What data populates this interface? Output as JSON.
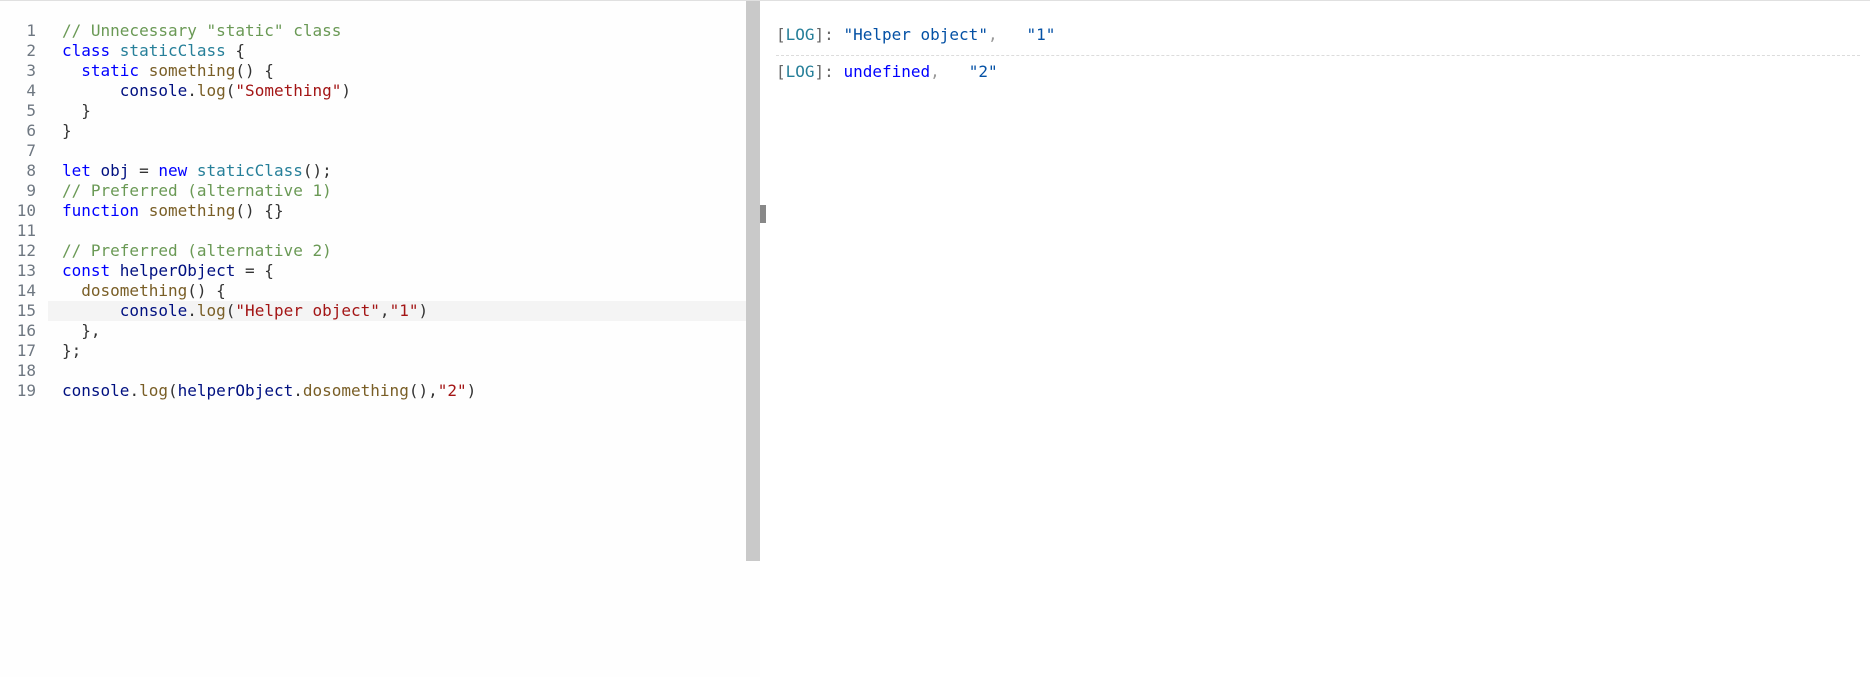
{
  "editor": {
    "highlighted_line_index": 14,
    "lines": [
      {
        "num": 1,
        "tokens": [
          {
            "t": "// Unnecessary \"static\" class",
            "c": "tok-comment"
          }
        ]
      },
      {
        "num": 2,
        "tokens": [
          {
            "t": "class ",
            "c": "tok-keyword"
          },
          {
            "t": "staticClass",
            "c": "tok-ident"
          },
          {
            "t": " {",
            "c": "tok-punct"
          }
        ]
      },
      {
        "num": 3,
        "tokens": [
          {
            "t": "  ",
            "c": ""
          },
          {
            "t": "static ",
            "c": "tok-keyword"
          },
          {
            "t": "something",
            "c": "tok-func"
          },
          {
            "t": "() {",
            "c": "tok-punct"
          }
        ]
      },
      {
        "num": 4,
        "tokens": [
          {
            "t": "      ",
            "c": ""
          },
          {
            "t": "console",
            "c": "tok-var"
          },
          {
            "t": ".",
            "c": "tok-punct"
          },
          {
            "t": "log",
            "c": "tok-func"
          },
          {
            "t": "(",
            "c": "tok-punct"
          },
          {
            "t": "\"Something\"",
            "c": "tok-string"
          },
          {
            "t": ")",
            "c": "tok-punct"
          }
        ]
      },
      {
        "num": 5,
        "tokens": [
          {
            "t": "  }",
            "c": "tok-punct"
          }
        ]
      },
      {
        "num": 6,
        "tokens": [
          {
            "t": "}",
            "c": "tok-punct"
          }
        ]
      },
      {
        "num": 7,
        "tokens": [
          {
            "t": "",
            "c": ""
          }
        ]
      },
      {
        "num": 8,
        "tokens": [
          {
            "t": "let ",
            "c": "tok-keyword"
          },
          {
            "t": "obj",
            "c": "tok-var"
          },
          {
            "t": " = ",
            "c": "tok-op"
          },
          {
            "t": "new ",
            "c": "tok-keyword"
          },
          {
            "t": "staticClass",
            "c": "tok-ident"
          },
          {
            "t": "();",
            "c": "tok-punct"
          }
        ]
      },
      {
        "num": 9,
        "tokens": [
          {
            "t": "// Preferred (alternative 1)",
            "c": "tok-comment"
          }
        ]
      },
      {
        "num": 10,
        "tokens": [
          {
            "t": "function ",
            "c": "tok-keyword"
          },
          {
            "t": "something",
            "c": "tok-func"
          },
          {
            "t": "() {}",
            "c": "tok-punct"
          }
        ]
      },
      {
        "num": 11,
        "tokens": [
          {
            "t": "",
            "c": ""
          }
        ]
      },
      {
        "num": 12,
        "tokens": [
          {
            "t": "// Preferred (alternative 2)",
            "c": "tok-comment"
          }
        ]
      },
      {
        "num": 13,
        "tokens": [
          {
            "t": "const ",
            "c": "tok-keyword"
          },
          {
            "t": "helperObject",
            "c": "tok-var"
          },
          {
            "t": " = {",
            "c": "tok-punct"
          }
        ]
      },
      {
        "num": 14,
        "tokens": [
          {
            "t": "  ",
            "c": ""
          },
          {
            "t": "dosomething",
            "c": "tok-func"
          },
          {
            "t": "() {",
            "c": "tok-punct"
          }
        ]
      },
      {
        "num": 15,
        "tokens": [
          {
            "t": "      ",
            "c": ""
          },
          {
            "t": "console",
            "c": "tok-var"
          },
          {
            "t": ".",
            "c": "tok-punct"
          },
          {
            "t": "log",
            "c": "tok-func"
          },
          {
            "t": "(",
            "c": "tok-punct"
          },
          {
            "t": "\"Helper object\"",
            "c": "tok-string"
          },
          {
            "t": ",",
            "c": "tok-punct"
          },
          {
            "t": "\"1\"",
            "c": "tok-string"
          },
          {
            "t": ")",
            "c": "tok-punct"
          }
        ]
      },
      {
        "num": 16,
        "tokens": [
          {
            "t": "  },",
            "c": "tok-punct"
          }
        ]
      },
      {
        "num": 17,
        "tokens": [
          {
            "t": "};",
            "c": "tok-punct"
          }
        ]
      },
      {
        "num": 18,
        "tokens": [
          {
            "t": "",
            "c": ""
          }
        ]
      },
      {
        "num": 19,
        "tokens": [
          {
            "t": "console",
            "c": "tok-var"
          },
          {
            "t": ".",
            "c": "tok-punct"
          },
          {
            "t": "log",
            "c": "tok-func"
          },
          {
            "t": "(",
            "c": "tok-punct"
          },
          {
            "t": "helperObject",
            "c": "tok-var"
          },
          {
            "t": ".",
            "c": "tok-punct"
          },
          {
            "t": "dosomething",
            "c": "tok-func"
          },
          {
            "t": "(),",
            "c": "tok-punct"
          },
          {
            "t": "\"2\"",
            "c": "tok-string"
          },
          {
            "t": ")",
            "c": "tok-punct"
          }
        ]
      }
    ]
  },
  "output": {
    "logs": [
      {
        "tag": "LOG",
        "parts": [
          {
            "v": "\"Helper object\"",
            "k": "str"
          },
          {
            "v": "\"1\"",
            "k": "str"
          }
        ]
      },
      {
        "tag": "LOG",
        "parts": [
          {
            "v": "undefined",
            "k": "undef"
          },
          {
            "v": "\"2\"",
            "k": "str"
          }
        ]
      }
    ]
  }
}
